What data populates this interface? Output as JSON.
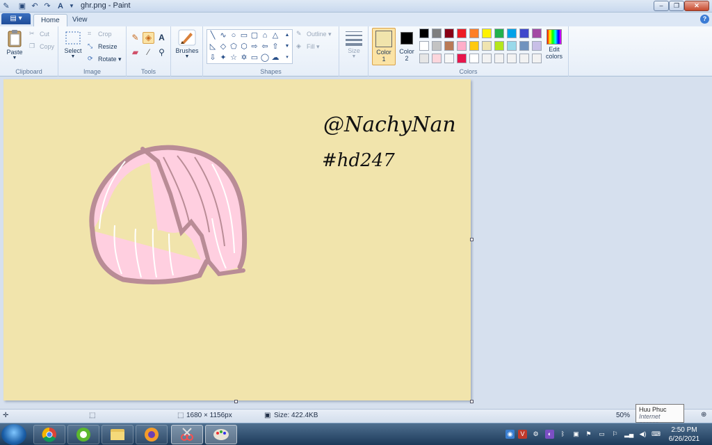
{
  "window": {
    "title": "ghr.png - Paint",
    "minimize": "–",
    "maximize": "❐",
    "close": "✕"
  },
  "tabs": {
    "home": "Home",
    "view": "View"
  },
  "ribbon": {
    "clipboard": {
      "label": "Clipboard",
      "paste": "Paste",
      "cut": "Cut",
      "copy": "Copy"
    },
    "image": {
      "label": "Image",
      "select": "Select",
      "crop": "Crop",
      "resize": "Resize",
      "rotate": "Rotate"
    },
    "tools": {
      "label": "Tools"
    },
    "brushes": {
      "label": "Brushes"
    },
    "shapes": {
      "label": "Shapes",
      "outline": "Outline",
      "fill": "Fill"
    },
    "size": {
      "label": "Size"
    },
    "colors": {
      "label": "Colors",
      "color1": "Color",
      "color1_num": "1",
      "color2": "Color",
      "color2_num": "2",
      "edit": "Edit",
      "edit2": "colors",
      "color1_hex": "#f1e4ac",
      "color2_hex": "#000000",
      "palette_row1": [
        "#000000",
        "#7f7f7f",
        "#880015",
        "#ed1c24",
        "#ff7f27",
        "#fff200",
        "#22b14c",
        "#00a2e8",
        "#3f48cc",
        "#a349a4"
      ],
      "palette_row2": [
        "#ffffff",
        "#c3c3c3",
        "#b97a57",
        "#ffaec9",
        "#ffc90e",
        "#efe4b0",
        "#b5e61d",
        "#99d9ea",
        "#7092be",
        "#c8bfe7"
      ],
      "palette_row3": [
        "#e6e6e6",
        "#fcd6dc",
        "#f7f7f7",
        "#e7164b",
        "#ffffff",
        "#f2f2f2",
        "#f2f2f2",
        "#f2f2f2",
        "#f2f2f2",
        "#f2f2f2"
      ]
    }
  },
  "canvas": {
    "text_line1": "@NachyNan",
    "text_line2": "#hd247",
    "bg_color": "#f1e4ac"
  },
  "status": {
    "dimensions": "1680 × 1156px",
    "size": "Size: 422.4KB",
    "zoom": "50%"
  },
  "tooltip": {
    "name": "Huu Phuc",
    "status": "Internet access"
  },
  "clock": {
    "time": "2:50 PM",
    "date": "6/26/2021"
  }
}
